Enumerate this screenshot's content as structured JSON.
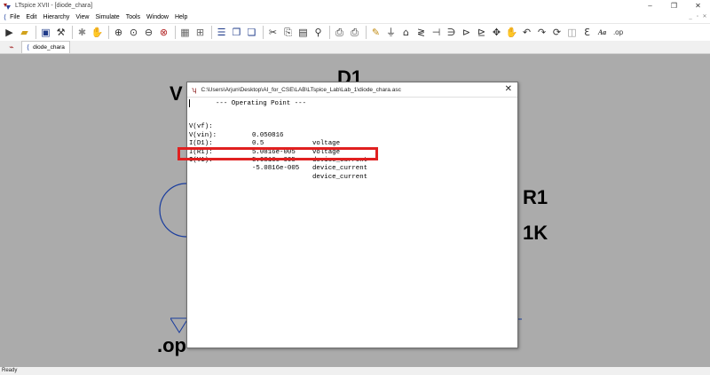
{
  "app": {
    "title": "LTspice XVII - [diode_chara]"
  },
  "window_controls": {
    "minimize": "–",
    "restore": "❐",
    "close": "✕"
  },
  "mdi_controls": {
    "minimize": "_",
    "restore": "▫",
    "close": "✕"
  },
  "menubar": {
    "items": [
      "File",
      "Edit",
      "Hierarchy",
      "View",
      "Simulate",
      "Tools",
      "Window",
      "Help"
    ]
  },
  "toolbar": {
    "text_tool_label": "Aa",
    "op_tool_label": ".op",
    "ground_label": "Ɛ",
    "icons": [
      "run-icon",
      "open-icon",
      "save-icon",
      "control-panel-icon",
      "halt-icon",
      "pan-icon",
      "zoom-in-icon",
      "zoom-area-icon",
      "zoom-out-icon",
      "zoom-cancel-icon",
      "autorange-icon",
      "grid-icon",
      "tile-icon",
      "cascade-icon",
      "cut-icon",
      "copy-icon",
      "paste-icon",
      "find-icon",
      "print-setup-icon",
      "print-icon",
      "draw-wire-icon",
      "ground-icon",
      "label-net-icon",
      "resistor-icon",
      "capacitor-icon",
      "inductor-icon",
      "diode-icon",
      "component-icon",
      "move-icon",
      "drag-icon",
      "undo-icon",
      "redo-icon",
      "rotate-icon",
      "mirror-icon"
    ]
  },
  "tabs": [
    {
      "label": "diode_chara",
      "active": true
    }
  ],
  "schematic": {
    "labels": {
      "d1": "D1",
      "v_partial": "V",
      "r1": "R1",
      "r1_value": "1K",
      "op_directive": ".op"
    }
  },
  "dialog": {
    "path": "C:\\Users\\Arjun\\Desktop\\AI_for_CSE\\LAB\\LTspice_Lab\\Lab_1\\diode_chara.asc",
    "close_label": "✕",
    "header": "--- Operating Point ---",
    "rows": [
      {
        "name": "V(vf):",
        "value": "0.050816",
        "unit": "voltage"
      },
      {
        "name": "V(vin):",
        "value": "0.5",
        "unit": "voltage"
      },
      {
        "name": "I(D1):",
        "value": "5.0816e-005",
        "unit": "device_current"
      },
      {
        "name": "I(R1):",
        "value": "5.0816e-005",
        "unit": "device_current"
      },
      {
        "name": "I(V1):",
        "value": "-5.0816e-005",
        "unit": "device_current"
      }
    ],
    "highlighted_row": 4
  },
  "status": {
    "text": "Ready"
  },
  "colors": {
    "canvas": "#ababab",
    "highlight": "#e02020",
    "component_blue": "#1a3d9e"
  }
}
